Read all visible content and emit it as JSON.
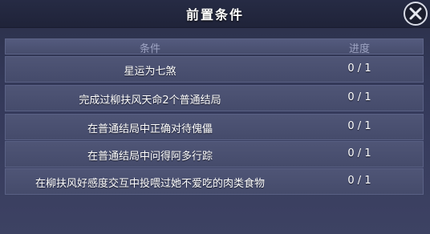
{
  "dialog": {
    "title": "前置条件"
  },
  "table": {
    "headers": {
      "condition": "条件",
      "progress": "进度"
    },
    "rows": [
      {
        "condition": "星运为七煞",
        "progress": "0 / 1"
      },
      {
        "condition": "完成过柳扶风天命2个普通结局",
        "progress": "0 / 1"
      },
      {
        "condition": "在普通结局中正确对待傀儡",
        "progress": "0 / 1"
      },
      {
        "condition": "在普通结局中问得阿多行踪",
        "progress": "0 / 1"
      },
      {
        "condition": "在柳扶风好感度交互中投喂过她不爱吃的肉类食物",
        "progress": "0 / 1"
      }
    ]
  },
  "icons": {
    "close": "close-icon"
  },
  "colors": {
    "panel_bg": "#34395a",
    "title_bar_bg": "#1f2339",
    "header_text": "#9da3c2",
    "row_bg": "#4a5070",
    "text": "#ffffff"
  }
}
